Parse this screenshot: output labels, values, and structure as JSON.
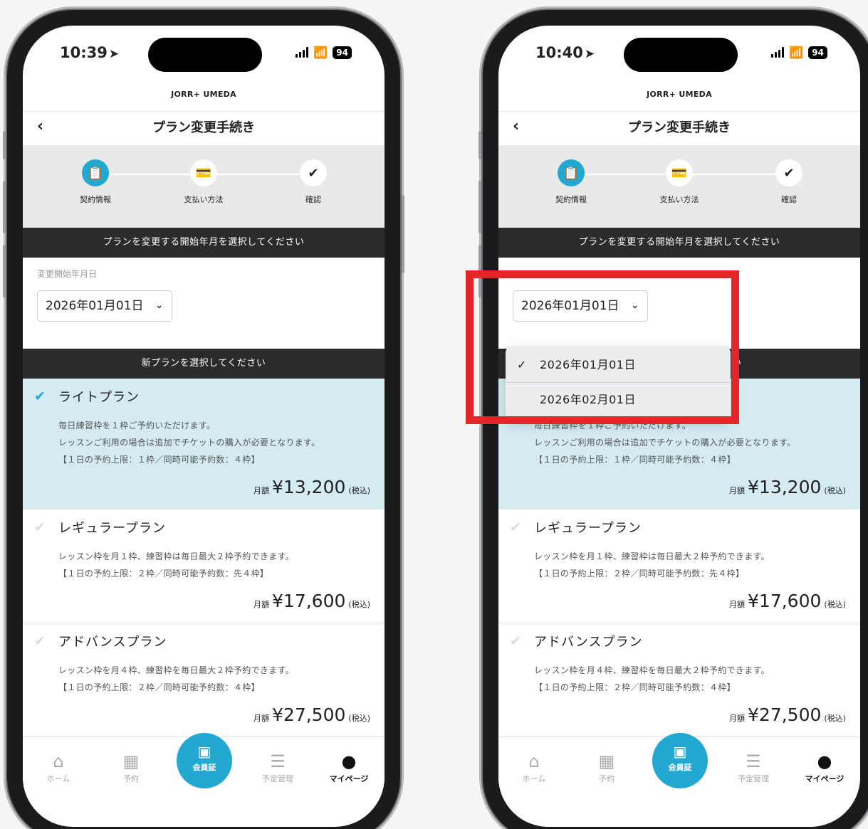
{
  "status": {
    "time_left": "10:39",
    "time_right": "10:40",
    "battery": "94"
  },
  "store_name": "JORR+ UMEDA",
  "nav": {
    "back": "‹",
    "title": "プラン変更手続き"
  },
  "steps": [
    {
      "label": "契約情報",
      "icon": "📋"
    },
    {
      "label": "支払い方法",
      "icon": "💳"
    },
    {
      "label": "確認",
      "icon": "✔"
    }
  ],
  "section_start": "プランを変更する開始年月を選択してください",
  "field_label": "変更開始年月日",
  "selected_date": "2026年01月01日",
  "section_plan": "新プランを選択してください",
  "plans": [
    {
      "name": "ライトプラン",
      "desc1": "毎日練習枠を１枠ご予約いただけます。",
      "desc2": "レッスンご利用の場合は追加でチケットの購入が必要となります。",
      "desc3": "【１日の予約上限：１枠／同時可能予約数：４枠】",
      "price": "¥13,200"
    },
    {
      "name": "レギュラープラン",
      "desc1": "レッスン枠を月１枠、練習枠は毎日最大２枠予約できます。",
      "desc2": "【１日の予約上限：２枠／同時可能予約数：先４枠】",
      "price": "¥17,600"
    },
    {
      "name": "アドバンスプラン",
      "desc1": "レッスン枠を月４枠、練習枠を毎日最大２枠予約できます。",
      "desc2": "【１日の予約上限：２枠／同時可能予約数：４枠】",
      "price": "¥27,500"
    }
  ],
  "price_prefix": "月額",
  "price_suffix": "(税込)",
  "tabs": {
    "home": "ホーム",
    "reserve": "予約",
    "card": "会員証",
    "schedule": "予定管理",
    "mypage": "マイページ"
  },
  "dropdown": {
    "tick": "✓",
    "options": [
      "2026年01月01日",
      "2026年02月01日"
    ]
  },
  "partial_text_right": "毎日練習枠を１枠ご予約いただけます。",
  "colors": {
    "accent": "#23a8d2",
    "highlight": "#e3262a",
    "selected_bg": "#d3ebf1",
    "dark_bar": "#2b2b2b"
  }
}
